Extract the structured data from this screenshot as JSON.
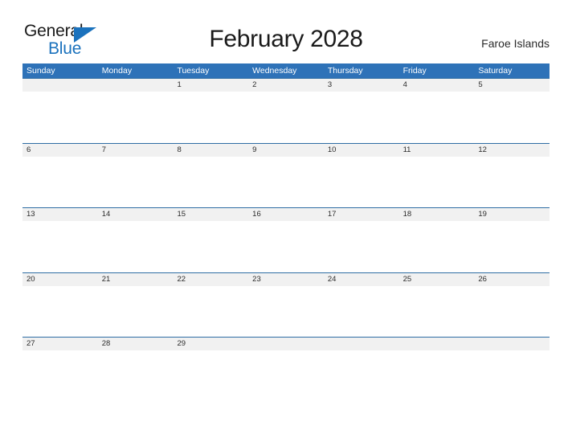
{
  "brand": {
    "name_part1": "General",
    "name_part2": "Blue",
    "flag_icon": "blue-triangle-flag-icon",
    "color_primary": "#1b72bd",
    "color_text": "#1a1a1a"
  },
  "header": {
    "title": "February 2028",
    "region": "Faroe Islands"
  },
  "calendar": {
    "colors": {
      "header_bar": "#2e72b8",
      "row_divider": "#2e6da4",
      "date_strip": "#f1f1f1",
      "header_text": "#ffffff",
      "date_text": "#2b2b2b"
    },
    "weekdays": [
      "Sunday",
      "Monday",
      "Tuesday",
      "Wednesday",
      "Thursday",
      "Friday",
      "Saturday"
    ],
    "weeks": [
      [
        "",
        "",
        "1",
        "2",
        "3",
        "4",
        "5"
      ],
      [
        "6",
        "7",
        "8",
        "9",
        "10",
        "11",
        "12"
      ],
      [
        "13",
        "14",
        "15",
        "16",
        "17",
        "18",
        "19"
      ],
      [
        "20",
        "21",
        "22",
        "23",
        "24",
        "25",
        "26"
      ],
      [
        "27",
        "28",
        "29",
        "",
        "",
        "",
        ""
      ]
    ]
  }
}
